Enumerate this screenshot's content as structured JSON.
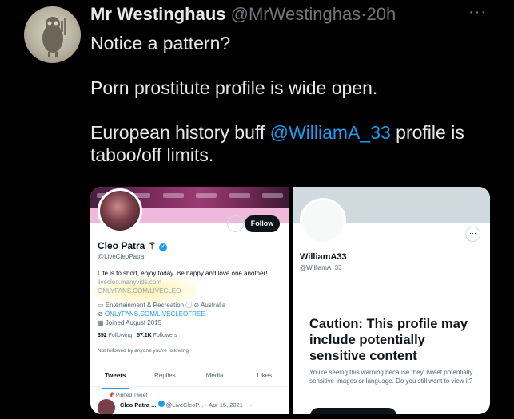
{
  "tweet": {
    "author_name": "Mr Westinghaus",
    "author_handle": "@MrWestinghas",
    "separator": "·",
    "time": "20h",
    "more": "···",
    "line1": "Notice a pattern?",
    "line2": "Porn prostitute profile is wide open.",
    "line3_before": "European history buff ",
    "line3_mention": "@WilliamA_33",
    "line3_after": " profile is taboo/off limits."
  },
  "left_profile": {
    "more": "···",
    "follow_label": "Follow",
    "name": "Cleo Patra",
    "name_emoji": "⚚",
    "verified": "✓",
    "handle": "@LiveCleoPatra",
    "bio": "Life is to short, enjoy today. Be happy and love one another!",
    "bio_link1": "livecleo.manyvids.com",
    "bio_link2": "ONLYFANS.COM/LIVECLEO",
    "category": "Entertainment & Recreation",
    "location": "Australia",
    "website": "ONLYFANS.COM/LIVECLEOFREE",
    "joined": "Joined August 2015",
    "following_count": "352",
    "following_label": "Following",
    "followers_count": "57.1K",
    "followers_label": "Followers",
    "not_followed": "Not followed by anyone you're following",
    "tabs": [
      "Tweets",
      "Replies",
      "Media",
      "Likes"
    ],
    "pinned_label": "Pinned Tweet",
    "pinned_name": "Cleo Patra ...",
    "pinned_handle": "@LiveCleoP...",
    "pinned_date": "· Apr 15, 2021",
    "pinned_more": "···"
  },
  "right_profile": {
    "more": "···",
    "name": "WilliamA33",
    "handle": "@WilliamA_33",
    "caution_title": "Caution: This profile may include potentially sensitive content",
    "caution_body": "You're seeing this warning because they Tweet potentially sensitive images or language. Do you still want to view it?"
  },
  "colors": {
    "background": "#000000",
    "text": "#e7e9ea",
    "muted": "#71767b",
    "accent": "#1d9bf0"
  }
}
